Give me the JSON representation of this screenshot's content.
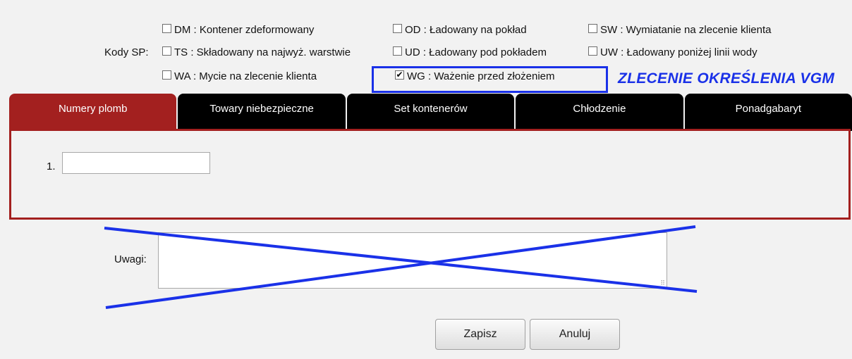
{
  "sp_codes": {
    "label": "Kody SP:",
    "checkboxes": [
      {
        "label": "DM : Kontener zdeformowany",
        "checked": false
      },
      {
        "label": "OD : Ładowany na pokład",
        "checked": false
      },
      {
        "label": "SW : Wymiatanie na zlecenie klienta",
        "checked": false
      },
      {
        "label": "TS : Składowany na najwyż. warstwie",
        "checked": false
      },
      {
        "label": "UD : Ładowany pod pokładem",
        "checked": false
      },
      {
        "label": "UW : Ładowany poniżej linii wody",
        "checked": false
      },
      {
        "label": "WA : Mycie na zlecenie klienta",
        "checked": false
      },
      {
        "label": "WG : Ważenie przed złożeniem",
        "checked": true
      }
    ]
  },
  "annotation": {
    "text": "ZLECENIE OKREŚLENIA VGM",
    "color": "#1a31e8"
  },
  "tabs": [
    {
      "label": "Numery plomb",
      "active": true
    },
    {
      "label": "Towary niebezpieczne",
      "active": false
    },
    {
      "label": "Set kontenerów",
      "active": false
    },
    {
      "label": "Chłodzenie",
      "active": false
    },
    {
      "label": "Ponadgabaryt",
      "active": false
    }
  ],
  "seal_panel": {
    "row_number": "1.",
    "value": ""
  },
  "remarks": {
    "label": "Uwagi:",
    "value": ""
  },
  "buttons": {
    "save_label": "Zapisz",
    "cancel_label": "Anuluj"
  },
  "colors": {
    "accent_red": "#a3201f",
    "annotation_blue": "#1a31e8",
    "background": "#f2f2f2"
  }
}
